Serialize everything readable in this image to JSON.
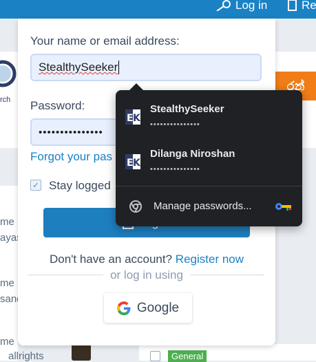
{
  "background": {
    "nav_login": "Log in",
    "nav_register": "Re",
    "logo_text": "rch",
    "banner_text": "රන්",
    "feed_lines": [
      "me",
      "ayas",
      "me",
      "sand",
      "me",
      "allrights"
    ],
    "tag_general": "General"
  },
  "login_form": {
    "name_label": "Your name or email address:",
    "name_value": "StealthySeeker",
    "password_label": "Password:",
    "password_value": "•••••••••••••••",
    "forgot_link": "Forgot your pas",
    "stay_logged_label": "Stay logged",
    "stay_logged_checked": true,
    "login_button": "Log in",
    "no_account_text": "Don't have an account?",
    "register_link": "Register now",
    "or_text": "or log in using",
    "google_button": "Google"
  },
  "password_popup": {
    "accounts": [
      {
        "name": "StealthySeeker",
        "password": "•••••••••••••••"
      },
      {
        "name": "Dilanga Niroshan",
        "password": "•••••••••••••••"
      }
    ],
    "manage_label": "Manage passwords..."
  },
  "colors": {
    "accent": "#1a82c4",
    "popup_bg": "#202124",
    "input_bg": "#e8f0fe",
    "banner_orange": "#f07d18",
    "tag_green": "#4caf50"
  }
}
